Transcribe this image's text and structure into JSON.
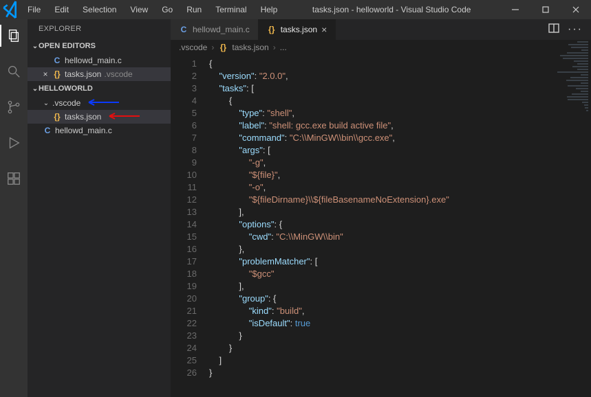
{
  "window": {
    "title": "tasks.json - helloworld - Visual Studio Code",
    "menu": [
      "File",
      "Edit",
      "Selection",
      "View",
      "Go",
      "Run",
      "Terminal",
      "Help"
    ]
  },
  "activitybar": [
    {
      "name": "explorer",
      "icon": "files-icon",
      "active": true
    },
    {
      "name": "search",
      "icon": "search-icon",
      "active": false
    },
    {
      "name": "scm",
      "icon": "branch-icon",
      "active": false
    },
    {
      "name": "run",
      "icon": "debug-icon",
      "active": false
    },
    {
      "name": "extensions",
      "icon": "extensions-icon",
      "active": false
    }
  ],
  "sidebar": {
    "title": "EXPLORER",
    "open_editors_label": "OPEN EDITORS",
    "open_editors": [
      {
        "icon": "C",
        "icon_kind": "c",
        "label": "hellowd_main.c",
        "detail": "",
        "active": false,
        "has_close": false
      },
      {
        "icon": "{}",
        "icon_kind": "json",
        "label": "tasks.json",
        "detail": ".vscode",
        "active": true,
        "has_close": true
      }
    ],
    "workspace_label": "HELLOWORLD",
    "tree": [
      {
        "depth": 1,
        "kind": "folder",
        "label": ".vscode",
        "selected": false,
        "expandable": true,
        "arrow": "blue"
      },
      {
        "depth": 2,
        "kind": "json",
        "label": "tasks.json",
        "selected": true,
        "expandable": false,
        "arrow": "red"
      },
      {
        "depth": 1,
        "kind": "c",
        "label": "hellowd_main.c",
        "selected": false,
        "expandable": false
      }
    ]
  },
  "tabs": [
    {
      "icon_kind": "c",
      "icon": "C",
      "label": "hellowd_main.c",
      "active": false,
      "closeable": false
    },
    {
      "icon_kind": "json",
      "icon": "{}",
      "label": "tasks.json",
      "active": true,
      "closeable": true
    }
  ],
  "breadcrumb": [
    {
      "kind": "text",
      "label": ".vscode"
    },
    {
      "kind": "json",
      "label": "tasks.json"
    },
    {
      "kind": "ellipsis",
      "label": "..."
    }
  ],
  "code": {
    "lines": [
      {
        "n": 1,
        "tokens": [
          [
            "brace",
            "{"
          ]
        ]
      },
      {
        "n": 2,
        "tokens": [
          [
            "indent",
            "    "
          ],
          [
            "key",
            "\"version\""
          ],
          [
            "punc",
            ": "
          ],
          [
            "str",
            "\"2.0.0\""
          ],
          [
            "punc",
            ","
          ]
        ]
      },
      {
        "n": 3,
        "tokens": [
          [
            "indent",
            "    "
          ],
          [
            "key",
            "\"tasks\""
          ],
          [
            "punc",
            ": ["
          ]
        ]
      },
      {
        "n": 4,
        "tokens": [
          [
            "indent",
            "        "
          ],
          [
            "brace",
            "{"
          ]
        ]
      },
      {
        "n": 5,
        "tokens": [
          [
            "indent",
            "            "
          ],
          [
            "key",
            "\"type\""
          ],
          [
            "punc",
            ": "
          ],
          [
            "str",
            "\"shell\""
          ],
          [
            "punc",
            ","
          ]
        ]
      },
      {
        "n": 6,
        "tokens": [
          [
            "indent",
            "            "
          ],
          [
            "key",
            "\"label\""
          ],
          [
            "punc",
            ": "
          ],
          [
            "str",
            "\"shell: gcc.exe build active file\""
          ],
          [
            "punc",
            ","
          ]
        ]
      },
      {
        "n": 7,
        "tokens": [
          [
            "indent",
            "            "
          ],
          [
            "key",
            "\"command\""
          ],
          [
            "punc",
            ": "
          ],
          [
            "str",
            "\"C:\\\\MinGW\\\\bin\\\\gcc.exe\""
          ],
          [
            "punc",
            ","
          ]
        ]
      },
      {
        "n": 8,
        "tokens": [
          [
            "indent",
            "            "
          ],
          [
            "key",
            "\"args\""
          ],
          [
            "punc",
            ": ["
          ]
        ]
      },
      {
        "n": 9,
        "tokens": [
          [
            "indent",
            "                "
          ],
          [
            "str",
            "\"-g\""
          ],
          [
            "punc",
            ","
          ]
        ]
      },
      {
        "n": 10,
        "tokens": [
          [
            "indent",
            "                "
          ],
          [
            "str",
            "\"${file}\""
          ],
          [
            "punc",
            ","
          ]
        ]
      },
      {
        "n": 11,
        "tokens": [
          [
            "indent",
            "                "
          ],
          [
            "str",
            "\"-o\""
          ],
          [
            "punc",
            ","
          ]
        ]
      },
      {
        "n": 12,
        "tokens": [
          [
            "indent",
            "                "
          ],
          [
            "str",
            "\"${fileDirname}\\\\${fileBasenameNoExtension}.exe\""
          ]
        ]
      },
      {
        "n": 13,
        "tokens": [
          [
            "indent",
            "            "
          ],
          [
            "punc",
            "],"
          ]
        ]
      },
      {
        "n": 14,
        "tokens": [
          [
            "indent",
            "            "
          ],
          [
            "key",
            "\"options\""
          ],
          [
            "punc",
            ": {"
          ]
        ]
      },
      {
        "n": 15,
        "tokens": [
          [
            "indent",
            "                "
          ],
          [
            "key",
            "\"cwd\""
          ],
          [
            "punc",
            ": "
          ],
          [
            "str",
            "\"C:\\\\MinGW\\\\bin\""
          ]
        ]
      },
      {
        "n": 16,
        "tokens": [
          [
            "indent",
            "            "
          ],
          [
            "punc",
            "},"
          ]
        ]
      },
      {
        "n": 17,
        "tokens": [
          [
            "indent",
            "            "
          ],
          [
            "key",
            "\"problemMatcher\""
          ],
          [
            "punc",
            ": ["
          ]
        ]
      },
      {
        "n": 18,
        "tokens": [
          [
            "indent",
            "                "
          ],
          [
            "str",
            "\"$gcc\""
          ]
        ]
      },
      {
        "n": 19,
        "tokens": [
          [
            "indent",
            "            "
          ],
          [
            "punc",
            "],"
          ]
        ]
      },
      {
        "n": 20,
        "tokens": [
          [
            "indent",
            "            "
          ],
          [
            "key",
            "\"group\""
          ],
          [
            "punc",
            ": {"
          ]
        ]
      },
      {
        "n": 21,
        "tokens": [
          [
            "indent",
            "                "
          ],
          [
            "key",
            "\"kind\""
          ],
          [
            "punc",
            ": "
          ],
          [
            "str",
            "\"build\""
          ],
          [
            "punc",
            ","
          ]
        ]
      },
      {
        "n": 22,
        "tokens": [
          [
            "indent",
            "                "
          ],
          [
            "key",
            "\"isDefault\""
          ],
          [
            "punc",
            ": "
          ],
          [
            "kw",
            "true"
          ]
        ]
      },
      {
        "n": 23,
        "tokens": [
          [
            "indent",
            "            "
          ],
          [
            "brace",
            "}"
          ]
        ]
      },
      {
        "n": 24,
        "tokens": [
          [
            "indent",
            "        "
          ],
          [
            "brace",
            "}"
          ]
        ]
      },
      {
        "n": 25,
        "tokens": [
          [
            "indent",
            "    "
          ],
          [
            "punc",
            "]"
          ]
        ]
      },
      {
        "n": 26,
        "tokens": [
          [
            "brace",
            "}"
          ]
        ]
      }
    ]
  }
}
